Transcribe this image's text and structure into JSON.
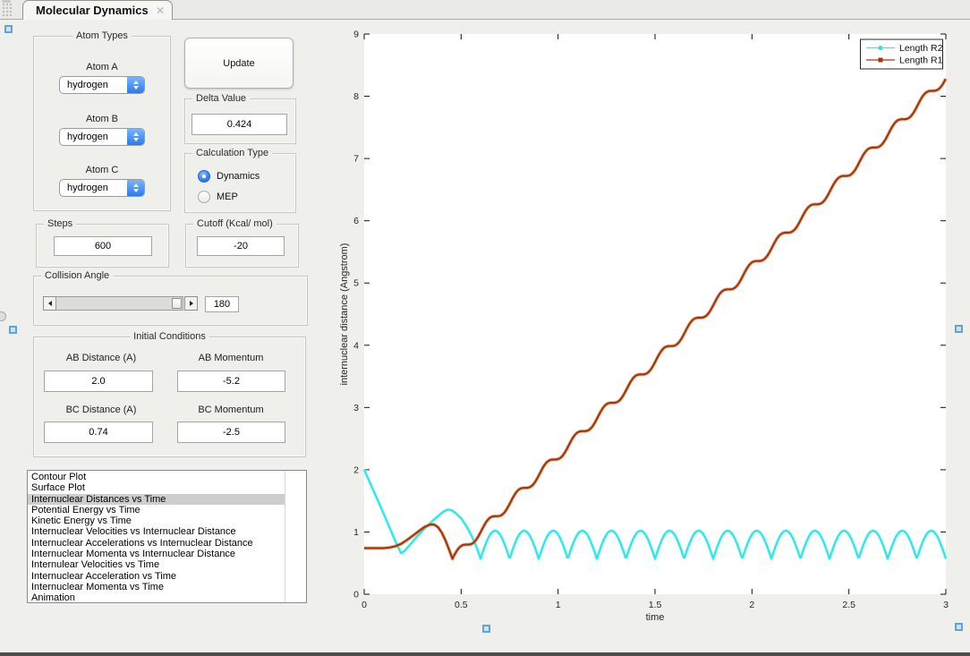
{
  "window": {
    "tab_title": "Molecular Dynamics",
    "close_icon": "✕"
  },
  "panels": {
    "atom_types": {
      "title": "Atom Types",
      "fields": [
        {
          "label": "Atom A",
          "value": "hydrogen"
        },
        {
          "label": "Atom B",
          "value": "hydrogen"
        },
        {
          "label": "Atom C",
          "value": "hydrogen"
        }
      ]
    },
    "update_button": "Update",
    "delta": {
      "title": "Delta Value",
      "value": "0.424"
    },
    "calc_type": {
      "title": "Calculation Type",
      "options": [
        {
          "label": "Dynamics",
          "selected": true
        },
        {
          "label": "MEP",
          "selected": false
        }
      ]
    },
    "steps": {
      "title": "Steps",
      "value": "600"
    },
    "cutoff": {
      "title": "Cutoff (Kcal/ mol)",
      "value": "-20"
    },
    "collision": {
      "title": "Collision Angle",
      "value": "180"
    },
    "initial": {
      "title": "Initial Conditions",
      "fields": [
        {
          "label": "AB Distance (A)",
          "value": "2.0"
        },
        {
          "label": "AB Momentum",
          "value": "-5.2"
        },
        {
          "label": "BC Distance (A)",
          "value": "0.74"
        },
        {
          "label": "BC Momentum",
          "value": "-2.5"
        }
      ]
    },
    "plot_list": {
      "selected_index": 2,
      "items": [
        "Contour Plot",
        "Surface Plot",
        "Internuclear Distances vs Time",
        "Potential Energy vs Time",
        "Kinetic Energy vs Time",
        "Internuclear Velocities vs Internuclear Distance",
        "Internuclear Accelerations vs Internuclear Distance",
        "Internuclear Momenta vs Internuclear Distance",
        "Internulear Velocities vs Time",
        "Internuclear Acceleration vs Time",
        "Internuclear Momenta vs Time",
        "Animation"
      ]
    }
  },
  "chart_data": {
    "type": "line",
    "xlabel": "time",
    "ylabel": "internuclear distance (Angstrom)",
    "xlim": [
      0,
      3
    ],
    "ylim": [
      0,
      9
    ],
    "x_ticks": [
      0,
      0.5,
      1,
      1.5,
      2,
      2.5,
      3
    ],
    "x_tick_labels": [
      "0",
      "0.5",
      "1",
      "1.5",
      "2",
      "2.5",
      "3"
    ],
    "y_ticks": [
      0,
      1,
      2,
      3,
      4,
      5,
      6,
      7,
      8,
      9
    ],
    "grid": false,
    "legend_position": "top-right",
    "series": [
      {
        "name": "Length R2",
        "color": "#2de6e6",
        "halo": "#a6f3f3",
        "marker": "dot",
        "segments": [
          {
            "type": "points",
            "pts": [
              [
                0,
                2.0
              ],
              [
                0.04,
                1.72
              ],
              [
                0.08,
                1.44
              ],
              [
                0.12,
                1.15
              ],
              [
                0.15,
                0.93
              ],
              [
                0.17,
                0.79
              ],
              [
                0.19,
                0.66
              ],
              [
                0.21,
                0.7
              ],
              [
                0.24,
                0.81
              ],
              [
                0.27,
                0.92
              ],
              [
                0.3,
                1.02
              ],
              [
                0.33,
                1.11
              ],
              [
                0.36,
                1.2
              ],
              [
                0.39,
                1.28
              ],
              [
                0.41,
                1.33
              ],
              [
                0.43,
                1.36
              ],
              [
                0.45,
                1.35
              ],
              [
                0.47,
                1.31
              ],
              [
                0.5,
                1.22
              ],
              [
                0.53,
                1.08
              ],
              [
                0.56,
                0.9
              ],
              [
                0.58,
                0.75
              ],
              [
                0.6,
                0.58
              ]
            ]
          },
          {
            "type": "abs_sine",
            "t0": 0.6,
            "t1": 3.0,
            "min": 0.57,
            "max": 1.02,
            "period": 0.15
          }
        ]
      },
      {
        "name": "Length R1",
        "color": "#a23709",
        "halo": "#cf7b4f",
        "marker": "square",
        "segments": [
          {
            "type": "points",
            "pts": [
              [
                0,
                0.74
              ],
              [
                0.06,
                0.74
              ],
              [
                0.1,
                0.74
              ],
              [
                0.13,
                0.75
              ],
              [
                0.16,
                0.77
              ],
              [
                0.19,
                0.81
              ],
              [
                0.22,
                0.87
              ],
              [
                0.25,
                0.94
              ],
              [
                0.28,
                1.01
              ],
              [
                0.31,
                1.08
              ],
              [
                0.34,
                1.12
              ],
              [
                0.36,
                1.12
              ],
              [
                0.38,
                1.08
              ],
              [
                0.4,
                0.99
              ],
              [
                0.42,
                0.86
              ],
              [
                0.44,
                0.7
              ],
              [
                0.455,
                0.57
              ]
            ]
          },
          {
            "type": "ramp_wiggle",
            "t0": 0.455,
            "t1": 3.0,
            "v0": 0.57,
            "slope": 3.037,
            "period": 0.15
          }
        ]
      }
    ]
  }
}
